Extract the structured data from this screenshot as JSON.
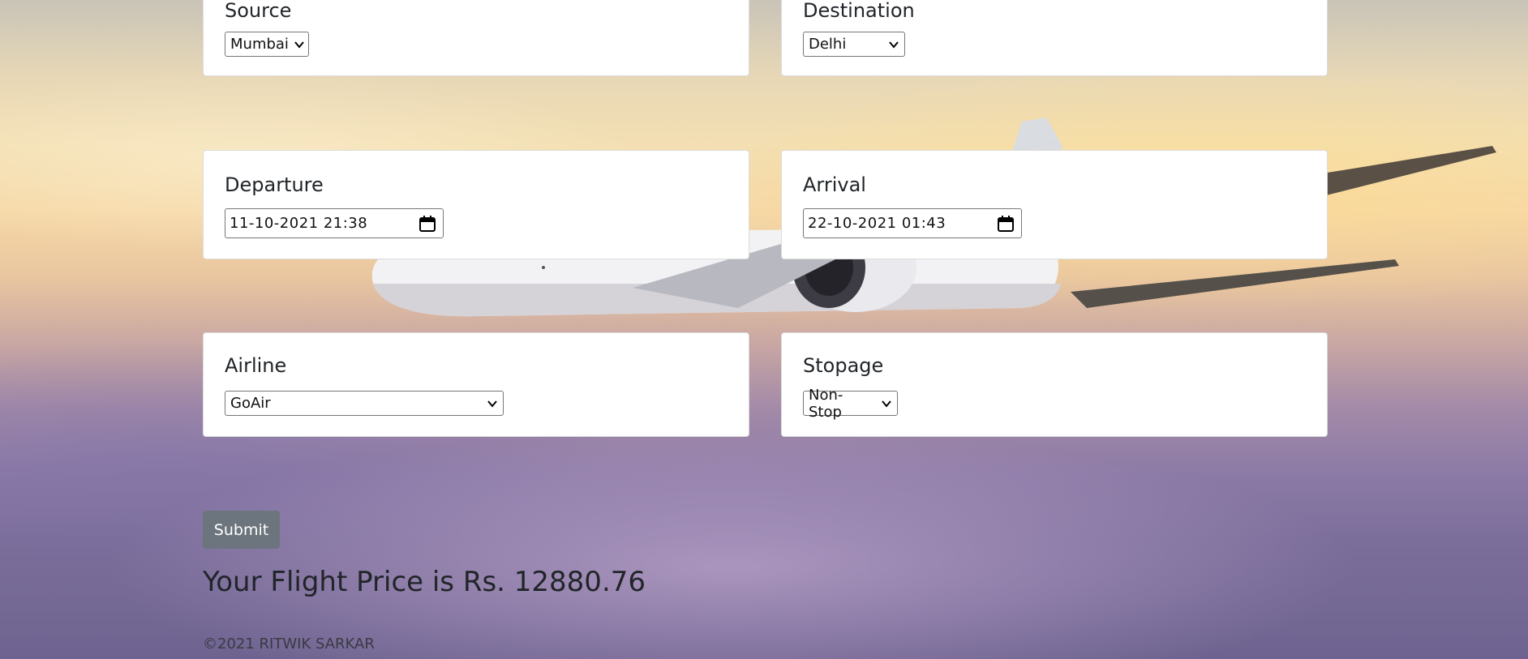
{
  "form": {
    "source": {
      "label": "Source",
      "value": "Mumbai"
    },
    "destination": {
      "label": "Destination",
      "value": "Delhi"
    },
    "departure": {
      "label": "Departure",
      "value": "11-10-2021 21:38"
    },
    "arrival": {
      "label": "Arrival",
      "value": "22-10-2021 01:43"
    },
    "airline": {
      "label": "Airline",
      "value": "GoAir"
    },
    "stopage": {
      "label": "Stopage",
      "value": "Non-Stop"
    }
  },
  "submit_label": "Submit",
  "result_text": "Your Flight Price is Rs. 12880.76",
  "footer_text": "©2021 RITWIK SARKAR",
  "colors": {
    "button_bg": "#6c757d",
    "card_bg": "#ffffff",
    "text": "#212529"
  },
  "icons": {
    "select_arrow": "chevron-down-icon",
    "date_picker": "calendar-icon"
  }
}
